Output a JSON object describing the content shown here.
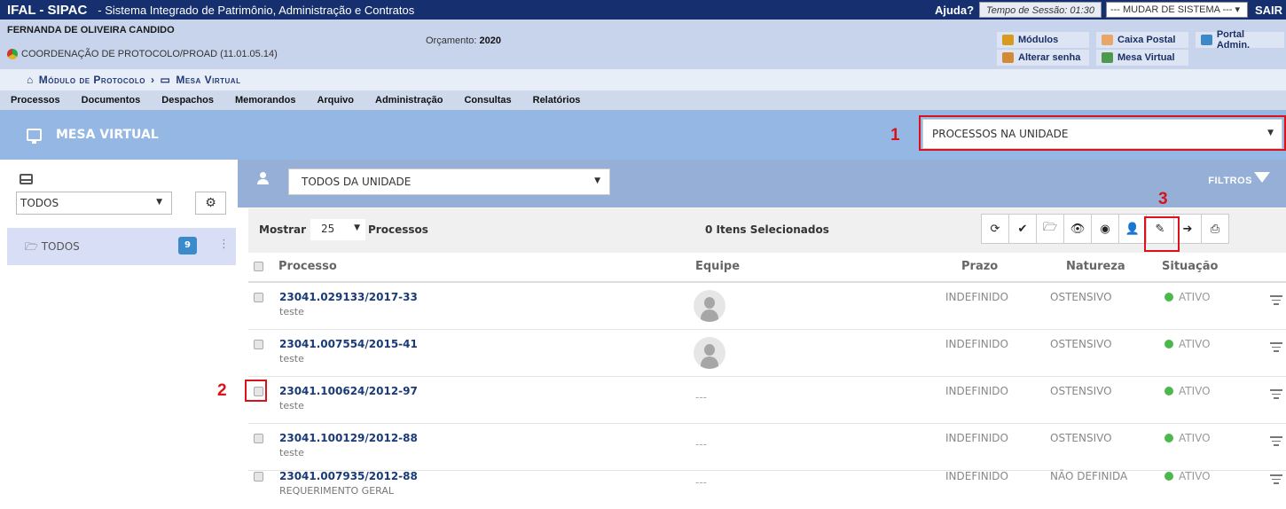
{
  "header": {
    "brand": "IFAL - SIPAC",
    "subtitle": "- Sistema Integrado de Patrimônio, Administração e Contratos",
    "help": "Ajuda?",
    "session": "Tempo de Sessão: 01:30",
    "system_select": "--- MUDAR DE SISTEMA ---",
    "exit": "SAIR"
  },
  "user": {
    "name": "FERNANDA DE OLIVEIRA CANDIDO",
    "unit": "COORDENAÇÃO DE PROTOCOLO/PROAD (11.01.05.14)",
    "budget_label": "Orçamento:",
    "budget_year": "2020"
  },
  "links": {
    "modulos": "Módulos",
    "caixa": "Caixa Postal",
    "portal": "Portal Admin.",
    "senha": "Alterar senha",
    "mesa": "Mesa Virtual"
  },
  "breadcrumb": [
    "Módulo de Protocolo",
    "›",
    "Mesa Virtual"
  ],
  "menu": [
    "Processos",
    "Documentos",
    "Despachos",
    "Memorandos",
    "Arquivo",
    "Administração",
    "Consultas",
    "Relatórios"
  ],
  "mesa": {
    "title": "MESA VIRTUAL",
    "dropdown": "PROCESSOS NA UNIDADE"
  },
  "annotations": [
    "1",
    "2",
    "3"
  ],
  "sidebar": {
    "select": "TODOS",
    "folder": "TODOS",
    "count": "9"
  },
  "filter": {
    "dropdown": "TODOS DA UNIDADE",
    "label": "FILTROS"
  },
  "toolbar": {
    "mostrar": "Mostrar",
    "page_size": "25",
    "processos": "Processos",
    "selected": "0 Itens Selecionados"
  },
  "columns": {
    "processo": "Processo",
    "equipe": "Equipe",
    "prazo": "Prazo",
    "natureza": "Natureza",
    "situacao": "Situação"
  },
  "rows": [
    {
      "num": "23041.029133/2017-33",
      "desc": "teste",
      "team": "",
      "prazo": "INDEFINIDO",
      "natureza": "OSTENSIVO",
      "situacao": "ATIVO"
    },
    {
      "num": "23041.007554/2015-41",
      "desc": "teste",
      "team": "",
      "prazo": "INDEFINIDO",
      "natureza": "OSTENSIVO",
      "situacao": "ATIVO"
    },
    {
      "num": "23041.100624/2012-97",
      "desc": "teste",
      "team": "---",
      "prazo": "INDEFINIDO",
      "natureza": "OSTENSIVO",
      "situacao": "ATIVO"
    },
    {
      "num": "23041.100129/2012-88",
      "desc": "teste",
      "team": "---",
      "prazo": "INDEFINIDO",
      "natureza": "OSTENSIVO",
      "situacao": "ATIVO"
    },
    {
      "num": "23041.007935/2012-88",
      "desc": "REQUERIMENTO GERAL",
      "team": "---",
      "prazo": "INDEFINIDO",
      "natureza": "NÃO DEFINIDA",
      "situacao": "ATIVO"
    }
  ],
  "colors": {
    "navy": "#16306f",
    "user_bar": "#c8d3ec",
    "mesa_bar": "#95b7e4",
    "annotation": "#d9121b",
    "active": "#4cb84c"
  }
}
